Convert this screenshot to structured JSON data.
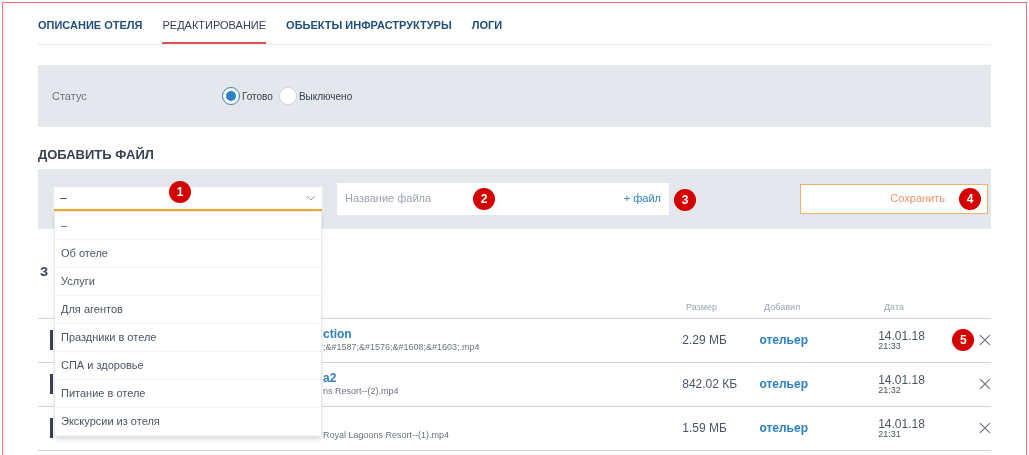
{
  "tabs": [
    {
      "label": "ОПИСАНИЕ ОТЕЛЯ",
      "selected": false
    },
    {
      "label": "РЕДАКТИРОВАНИЕ",
      "selected": true
    },
    {
      "label": "ОБЬЕКТЫ ИНФРАСТРУКТУРЫ",
      "selected": false
    },
    {
      "label": "ЛОГИ",
      "selected": false
    }
  ],
  "status": {
    "label": "Статус",
    "options": [
      {
        "label": "Готово",
        "selected": true
      },
      {
        "label": "Выключено",
        "selected": false
      }
    ]
  },
  "add_file": {
    "title": "ДОБАВИТЬ ФАЙЛ",
    "select": {
      "value": "–",
      "marker": "1",
      "expanded": true,
      "options": [
        "–",
        "Об отеле",
        "Услуги",
        "Для агентов",
        "Праздники в отеле",
        "СПА и здоровье",
        "Питание в отеле",
        "Экскурсии из отеля"
      ]
    },
    "name_field": {
      "placeholder": "Название файла",
      "marker": "2"
    },
    "file_link": {
      "label": "+ файл",
      "marker": "3"
    },
    "save_button": {
      "label": "Сохранить",
      "marker": "4"
    }
  },
  "files": {
    "title": "З",
    "columns": [
      "Размер",
      "Добавил",
      "Дата"
    ],
    "rows": [
      {
        "name": "ction",
        "file": ";&#1587;&#1576;&#1608;&#1603;.mp4",
        "size": "2.29 МБ",
        "added_by": "отельер",
        "date": "14.01.18",
        "time": "21:33",
        "marker": "5"
      },
      {
        "name": "a2",
        "file": "ns Resort--(2).mp4",
        "size": "842.02 КБ",
        "added_by": "отельер",
        "date": "14.01.18",
        "time": "21:32"
      },
      {
        "file": "Royal Lagoons Resort--(1).mp4",
        "size": "1.59 МБ",
        "added_by": "отельер",
        "date": "14.01.18",
        "time": "21:31"
      }
    ]
  }
}
